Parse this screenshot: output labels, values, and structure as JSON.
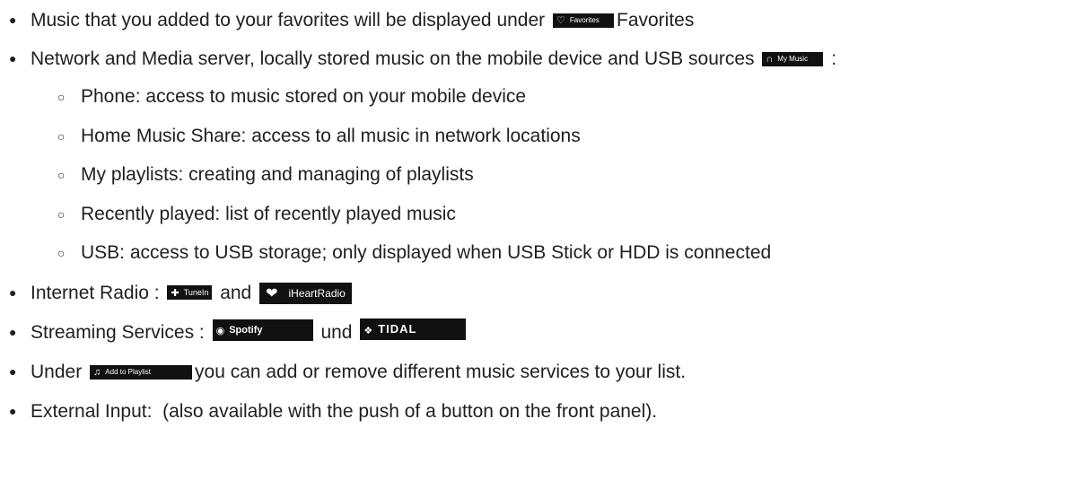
{
  "items": {
    "favorites": {
      "text_before": "Music that you added to your favorites will be displayed under",
      "badge": "Favorites",
      "text_after": "Favorites"
    },
    "network": {
      "text_before": "Network and Media server, locally stored music on the mobile device and USB sources",
      "badge": "My Music",
      "text_after": ":"
    },
    "sub": [
      "Phone: access to music stored on your mobile device",
      "Home Music Share: access to all music in network locations",
      "My playlists: creating and managing of playlists",
      "Recently played: list of recently played music",
      "USB: access to USB storage; only displayed when USB Stick or HDD is connected"
    ],
    "radio": {
      "text_before": "Internet Radio :",
      "badge1": "TuneIn",
      "conjunction": "and",
      "badge2": "iHeartRadio"
    },
    "streaming": {
      "text_before": "Streaming Services :",
      "badge1": "Spotify",
      "conjunction": "und",
      "badge2": "TIDAL"
    },
    "playlist": {
      "text_before": "Under",
      "badge": "Add to Playlist",
      "text_after": "you can add or remove different music services to your list."
    },
    "external": {
      "text": "External Input:  (also available with the push of a button on the front panel)."
    }
  },
  "icons": [
    "heart-icon",
    "headphones-icon",
    "tunein-icon",
    "iheart-icon",
    "spotify-icon",
    "tidal-icon",
    "playlist-icon"
  ]
}
